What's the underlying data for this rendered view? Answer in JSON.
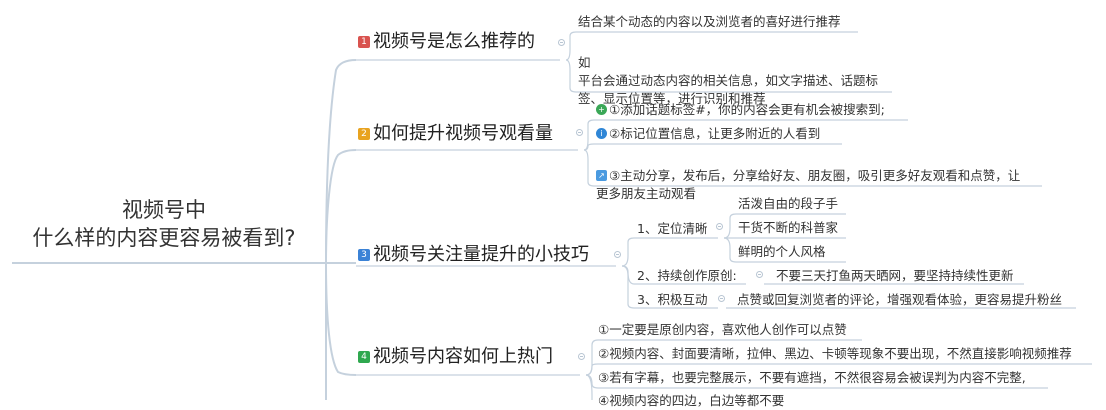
{
  "root": {
    "line1": "视频号中",
    "line2": "什么样的内容更容易被看到?"
  },
  "branches": [
    {
      "num": "1",
      "color": "#d9534f",
      "title": "视频号是怎么推荐的",
      "leaves": [
        "结合某个动态的内容以及浏览者的喜好进行推荐",
        "如\n平台会通过动态内容的相关信息，如文字描述、话题标\n签、显示位置等，进行识别和推荐"
      ]
    },
    {
      "num": "2",
      "color": "#e8a320",
      "title": "如何提升视频号观看量",
      "leaves": [
        {
          "icon": "plus-circle-icon",
          "icon_color": "#3aa757",
          "glyph": "+",
          "text": "①添加话题标签#，你的内容会更有机会被搜索到;"
        },
        {
          "icon": "info-circle-icon",
          "icon_color": "#2f86d6",
          "glyph": "i",
          "text": "②标记位置信息，让更多附近的人看到"
        },
        {
          "icon": "share-person-icon",
          "icon_color": "#4a9ae0",
          "glyph": "↗",
          "text": "③主动分享，发布后，分享给好友、朋友圈，吸引更多好友观看和点赞，让\n更多朋友主动观看"
        }
      ]
    },
    {
      "num": "3",
      "color": "#3b82d6",
      "title": "视频号关注量提升的小技巧",
      "subs": [
        {
          "label": "1、定位清晰",
          "children": [
            "活泼自由的段子手",
            "干货不断的科普家",
            "鲜明的个人风格"
          ]
        },
        {
          "label": "2、持续创作原创:",
          "children": [
            "不要三天打鱼两天晒网，要坚持持续性更新"
          ]
        },
        {
          "label": "3、积极互动",
          "children": [
            "点赞或回复浏览者的评论，增强观看体验，更容易提升粉丝"
          ]
        }
      ]
    },
    {
      "num": "4",
      "color": "#2fa84f",
      "title": "视频号内容如何上热门",
      "leaves": [
        "①一定要是原创内容，喜欢他人创作可以点赞",
        "②视频内容、封面要清晰，拉伸、黑边、卡顿等现象不要出现，不然直接影响视频推荐",
        "③若有字幕，也要完整展示，不要有遮挡，不然很容易会被误判为内容不完整,",
        "④视频内容的四边，白边等都不要"
      ]
    }
  ]
}
